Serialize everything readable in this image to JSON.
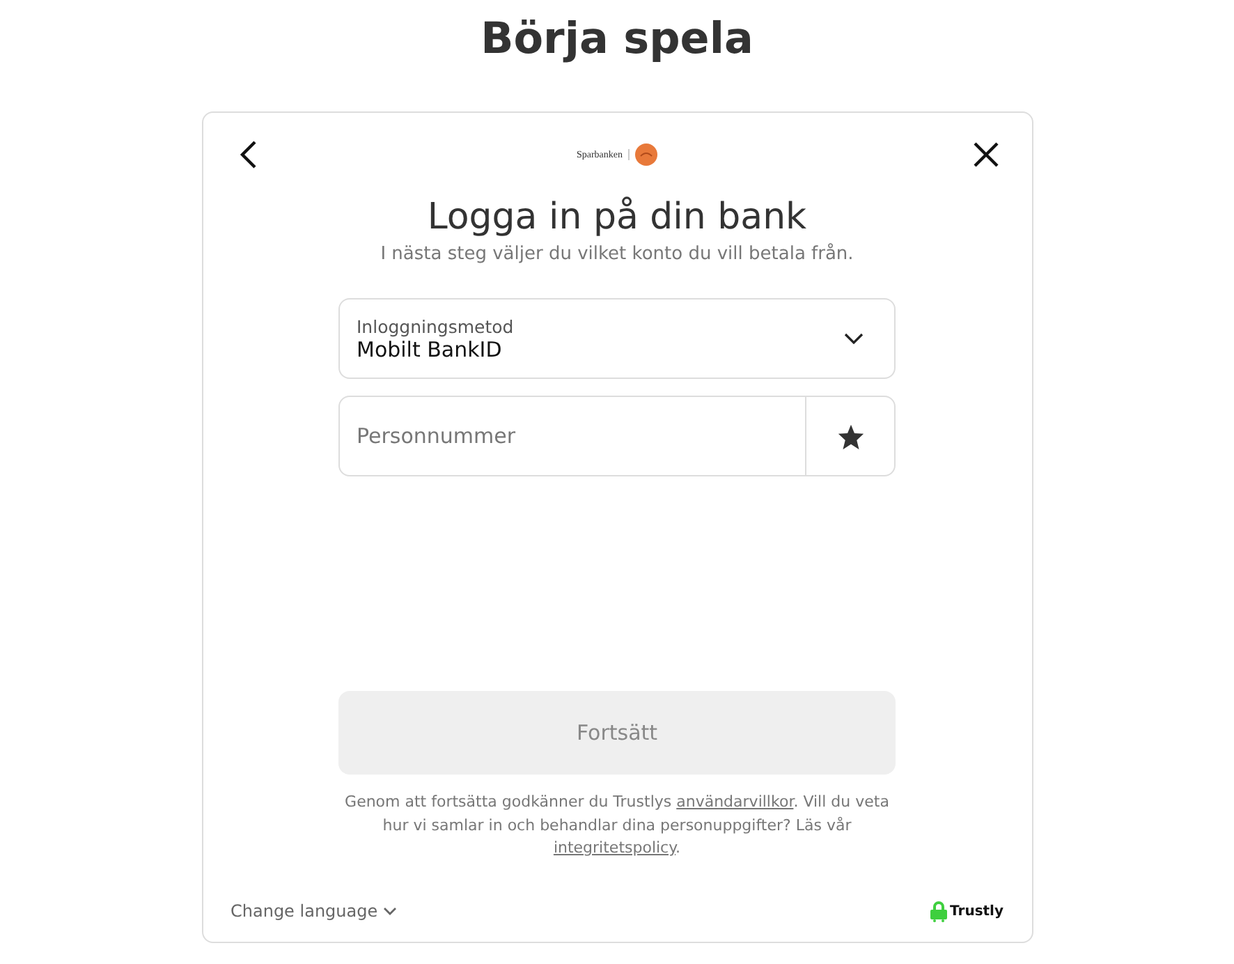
{
  "page_title": "Börja spela",
  "card": {
    "bank_logo": "Sparbanken",
    "heading": "Logga in på din bank",
    "subheading": "I nästa steg väljer du vilket konto du vill betala från.",
    "method_select": {
      "label": "Inloggningsmetod",
      "value": "Mobilt BankID"
    },
    "id_field": {
      "placeholder": "Personnummer"
    },
    "continue_button": {
      "label": "Fortsätt",
      "disabled": true
    },
    "consent": [
      {
        "kind": "text",
        "text": "Genom att fortsätta godkänner du Trustlys "
      },
      {
        "kind": "link",
        "text": "användarvillkor"
      },
      {
        "kind": "text",
        "text": ". Vill du veta hur vi samlar in och behandlar dina personuppgifter? Läs vår "
      },
      {
        "kind": "link",
        "text": "integritetspolicy"
      },
      {
        "kind": "text",
        "text": "."
      }
    ],
    "language_button": "Change language",
    "brand": "Trustly"
  }
}
